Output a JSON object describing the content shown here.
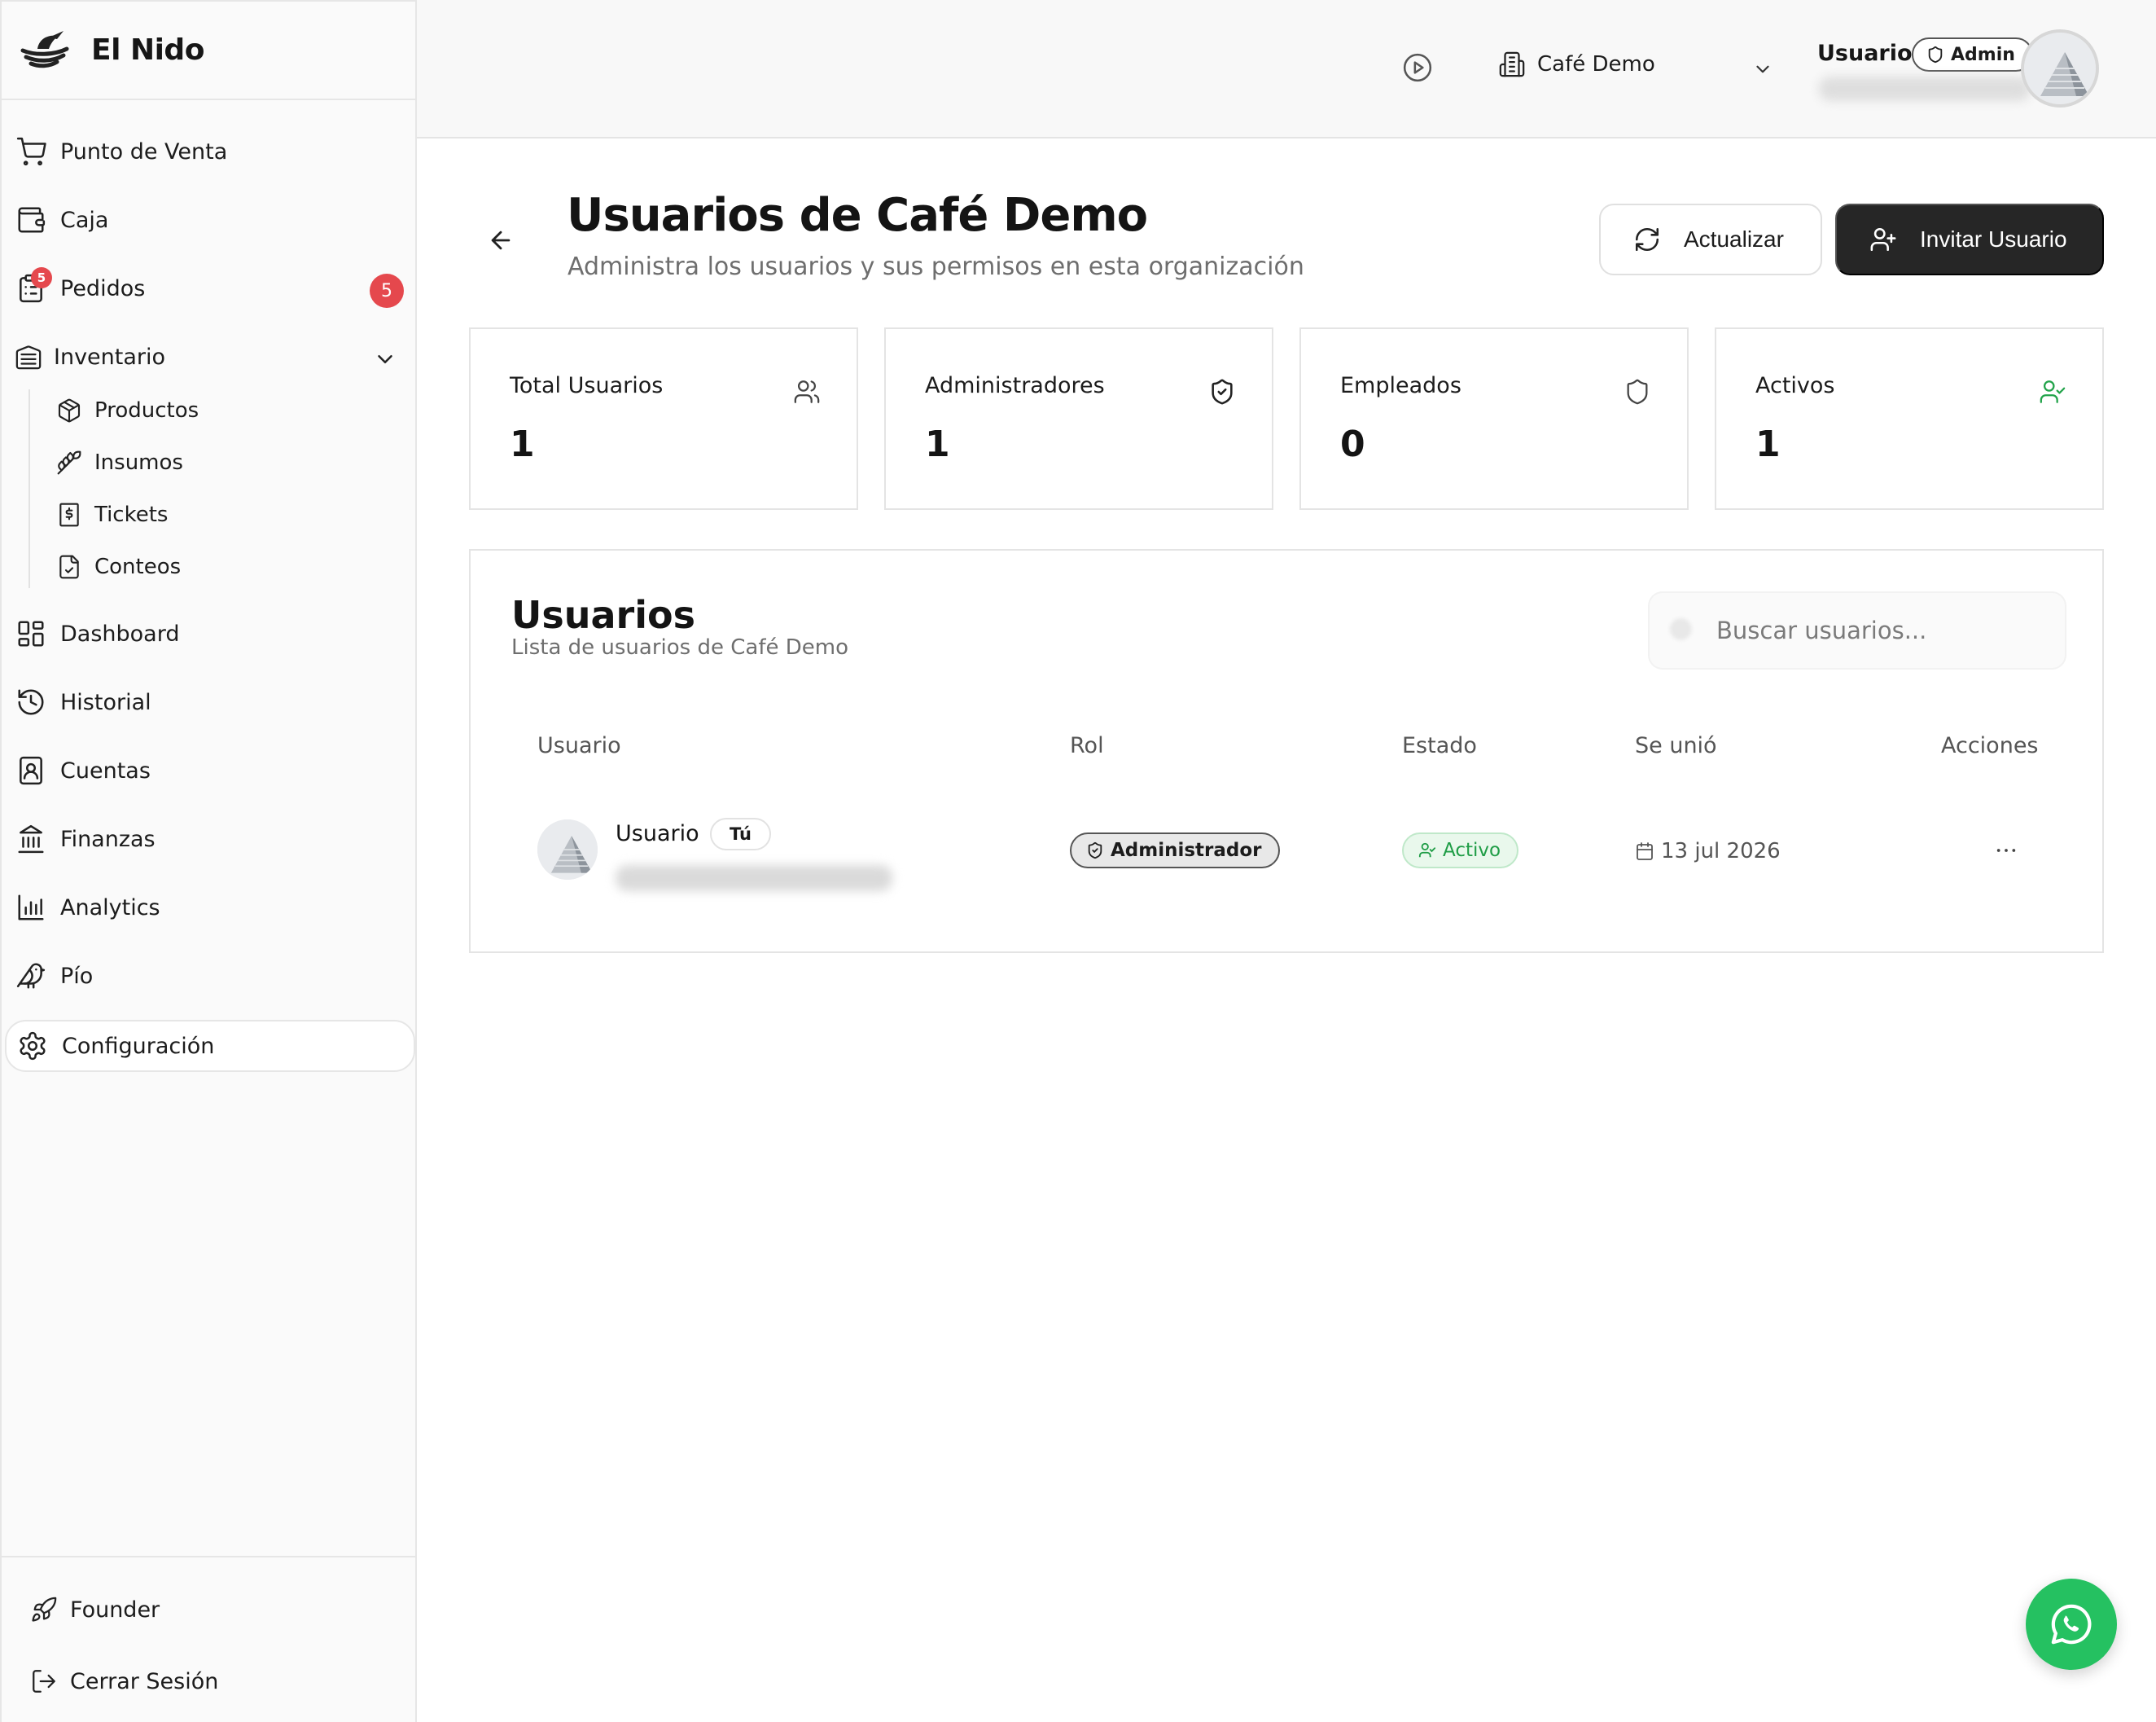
{
  "brand": {
    "name": "El Nido"
  },
  "sidebar": {
    "items": [
      {
        "label": "Punto de Venta",
        "icon": "shopping-cart-icon"
      },
      {
        "label": "Caja",
        "icon": "wallet-icon"
      },
      {
        "label": "Pedidos",
        "icon": "clipboard-list-icon",
        "badge": "5"
      },
      {
        "label": "Inventario",
        "icon": "warehouse-icon"
      },
      {
        "label": "Productos",
        "icon": "package-icon"
      },
      {
        "label": "Insumos",
        "icon": "wheat-icon"
      },
      {
        "label": "Tickets",
        "icon": "receipt-icon"
      },
      {
        "label": "Conteos",
        "icon": "file-check-icon"
      },
      {
        "label": "Dashboard",
        "icon": "layout-dashboard-icon"
      },
      {
        "label": "Historial",
        "icon": "history-icon"
      },
      {
        "label": "Cuentas",
        "icon": "contact-icon"
      },
      {
        "label": "Finanzas",
        "icon": "landmark-icon"
      },
      {
        "label": "Analytics",
        "icon": "bar-chart-icon"
      },
      {
        "label": "Pío",
        "icon": "bird-icon"
      },
      {
        "label": "Configuración",
        "icon": "settings-icon"
      }
    ],
    "footer": [
      {
        "label": "Founder",
        "icon": "rocket-icon"
      },
      {
        "label": "Cerrar Sesión",
        "icon": "log-out-icon"
      }
    ]
  },
  "header": {
    "organization": "Café Demo",
    "user_name": "Usuario",
    "role": "Admin"
  },
  "page": {
    "title": "Usuarios de Café Demo",
    "subtitle": "Administra los usuarios y sus permisos en esta organización",
    "refresh_label": "Actualizar",
    "invite_label": "Invitar Usuario"
  },
  "stats": [
    {
      "label": "Total Usuarios",
      "value": "1",
      "icon": "users-icon",
      "color": "#444444"
    },
    {
      "label": "Administradores",
      "value": "1",
      "icon": "shield-check-icon",
      "color": "#222222"
    },
    {
      "label": "Empleados",
      "value": "0",
      "icon": "shield-icon",
      "color": "#444444"
    },
    {
      "label": "Activos",
      "value": "1",
      "icon": "user-check-icon",
      "color": "#22a34a"
    }
  ],
  "users_card": {
    "title": "Usuarios",
    "subtitle": "Lista de usuarios de Café Demo",
    "search_placeholder": "Buscar usuarios...",
    "columns": [
      "Usuario",
      "Rol",
      "Estado",
      "Se unió",
      "Acciones"
    ],
    "rows": [
      {
        "name": "Usuario",
        "you_label": "Tú",
        "role": "Administrador",
        "status": "Activo",
        "joined": "13 jul 2026"
      }
    ]
  },
  "colors": {
    "accent_dark": "#262626",
    "danger": "#e5484d",
    "success": "#22a34a",
    "whatsapp": "#25c161"
  }
}
